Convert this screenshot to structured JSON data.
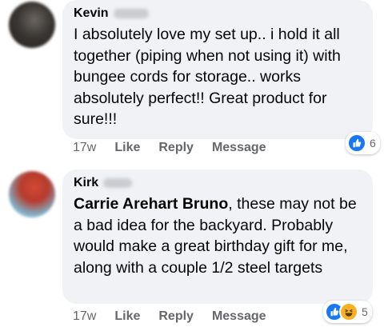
{
  "comments": [
    {
      "author": "Kevin",
      "text": "I absolutely love my set up..  i hold it all together (piping when not using it) with bungee cords for storage..  works absolutely perfect!! Great product for sure!!!",
      "timestamp": "17w",
      "actions": [
        "Like",
        "Reply",
        "Message"
      ],
      "reactions": {
        "icons": [
          "like-icon"
        ],
        "count": "6"
      }
    },
    {
      "author": "Kirk",
      "mention": "Carrie Arehart Bruno",
      "text": ", these may not be a bad idea for the backyard. Probably would make a great birthday gift for me, along with a couple 1/2 steel targets",
      "timestamp": "17w",
      "actions": [
        "Like",
        "Reply",
        "Message"
      ],
      "reactions": {
        "icons": [
          "like-icon",
          "haha-icon"
        ],
        "count": "5"
      }
    }
  ],
  "colors": {
    "bubble": "#f0f2f5",
    "meta": "#65676b",
    "like": "#1877f2",
    "haha": "#f7b125"
  }
}
